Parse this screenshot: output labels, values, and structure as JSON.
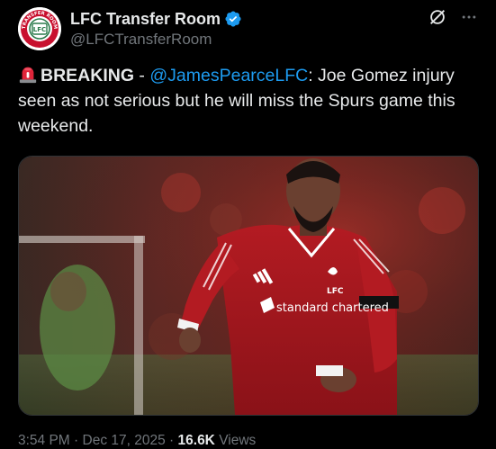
{
  "author": {
    "display_name": "LFC Transfer Room",
    "handle": "@LFCTransferRoom",
    "avatar_icon": "lfc-transfer-room-logo",
    "avatar_text_top": "TRANSFER ROOM",
    "avatar_text_center": "LFC",
    "verified_icon": "verified-badge-icon",
    "verified_color": "#1d9bf0"
  },
  "actions": {
    "grok_icon": "grok-icon",
    "more_icon": "more-icon"
  },
  "tweet": {
    "emoji": "rotating-light-icon",
    "breaking": "BREAKING",
    "separator": " - ",
    "mention": "@JamesPearceLFC",
    "body": ": Joe Gomez injury seen as not serious but he will miss the Spurs game this weekend.",
    "mention_color": "#1d9bf0"
  },
  "media": {
    "type": "photo",
    "jersey_sponsor": "standard chartered",
    "jersey_crest": "LFC"
  },
  "meta": {
    "time": "3:54 PM",
    "dot1": " · ",
    "date": "Dec 17, 2025",
    "dot2": " · ",
    "views_count": "16.6K",
    "views_label": " Views"
  }
}
